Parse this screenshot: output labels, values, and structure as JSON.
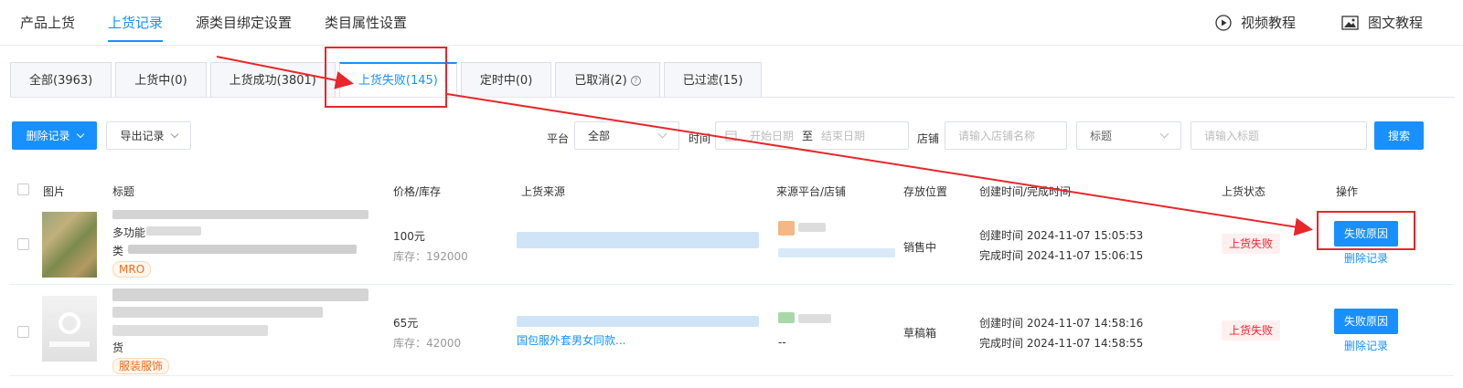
{
  "top_nav": {
    "items": [
      "产品上货",
      "上货记录",
      "源类目绑定设置",
      "类目属性设置"
    ],
    "active_index": 1,
    "video_tutorial": "视频教程",
    "image_tutorial": "图文教程"
  },
  "tabs": [
    {
      "label": "全部(3963)"
    },
    {
      "label": "上货中(0)"
    },
    {
      "label": "上货成功(3801)"
    },
    {
      "label": "上货失败(145)"
    },
    {
      "label": "定时中(0)"
    },
    {
      "label": "已取消(2)"
    },
    {
      "label": "已过滤(15)"
    }
  ],
  "active_tab": 3,
  "toolbar": {
    "delete_records": "删除记录",
    "export_records": "导出记录"
  },
  "filters": {
    "platform_label": "平台",
    "platform_value": "全部",
    "time_label": "时间",
    "start_date_placeholder": "开始日期",
    "date_separator": "至",
    "end_date_placeholder": "结束日期",
    "shop_label": "店铺",
    "shop_placeholder": "请输入店铺名称",
    "title_select": "标题",
    "title_placeholder": "请输入标题",
    "search_button": "搜索"
  },
  "table": {
    "columns": [
      "图片",
      "标题",
      "价格/库存",
      "上货来源",
      "来源平台/店铺",
      "存放位置",
      "创建时间/完成时间",
      "上货状态",
      "操作"
    ],
    "rows": [
      {
        "title_line1": "多功能",
        "title_line2": "类",
        "tag": "MRO",
        "price": "100元",
        "stock": "库存：192000",
        "location": "销售中",
        "created": "创建时间 2024-11-07 15:05:53",
        "finished": "完成时间 2024-11-07 15:06:15",
        "status": "上货失败",
        "fail_reason": "失败原因",
        "delete": "删除记录"
      },
      {
        "title_line1": "货",
        "tag": "服装服饰",
        "price": "65元",
        "stock": "库存：42000",
        "source_partial": "国包服外套男女同款...",
        "shop_partial": "--",
        "location": "草稿箱",
        "created": "创建时间 2024-11-07 14:58:16",
        "finished": "完成时间 2024-11-07 14:58:55",
        "status": "上货失败",
        "fail_reason": "失败原因",
        "delete": "删除记录"
      }
    ]
  },
  "annotation_color": "#e8262b",
  "accent_color": "#1890ff"
}
